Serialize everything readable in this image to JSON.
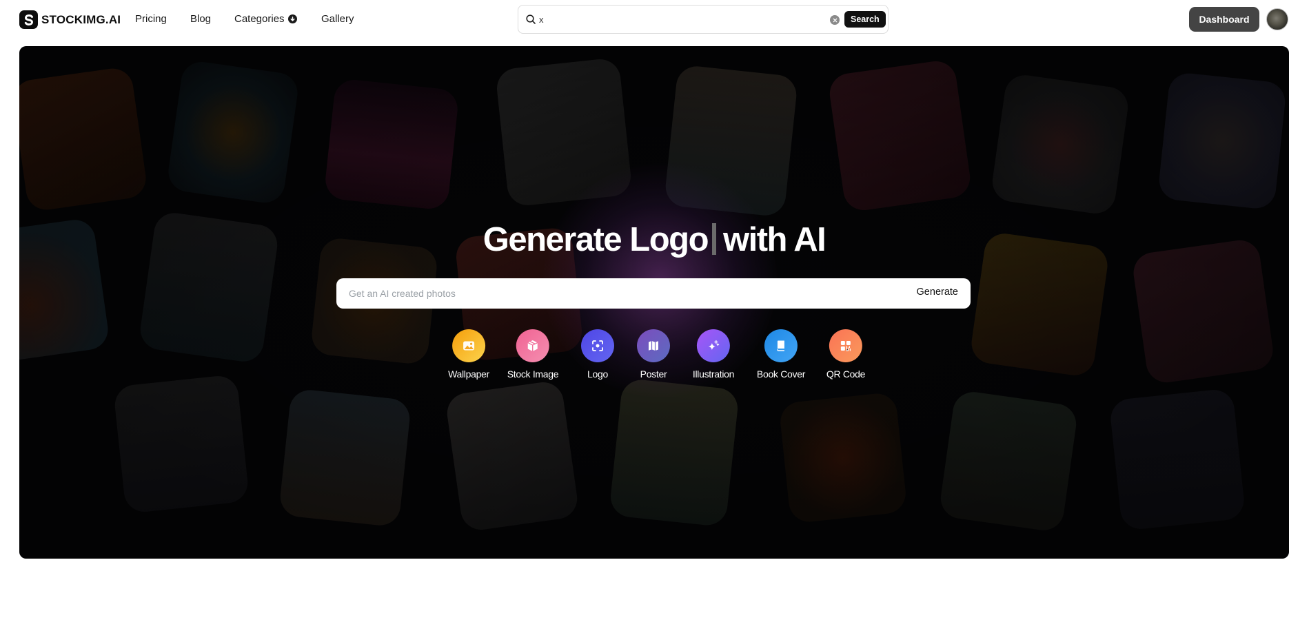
{
  "nav": {
    "brand": "STOCKIMG.AI",
    "links": [
      {
        "label": "Pricing"
      },
      {
        "label": "Blog"
      },
      {
        "label": "Categories",
        "has_dropdown": true
      },
      {
        "label": "Gallery"
      }
    ],
    "search": {
      "value": "x",
      "button_label": "Search"
    },
    "dashboard_label": "Dashboard"
  },
  "hero": {
    "headline_typed": "Generate Logo",
    "headline_rest": "with AI",
    "prompt": {
      "placeholder": "Get an AI created photos",
      "value": "",
      "button_label": "Generate"
    },
    "categories": [
      {
        "label": "Wallpaper",
        "icon": "image-icon",
        "gradient": [
          "#f59e0b",
          "#fcd34d"
        ]
      },
      {
        "label": "Stock Image",
        "icon": "package-icon",
        "gradient": [
          "#f06292",
          "#f48fb1"
        ]
      },
      {
        "label": "Logo",
        "icon": "focus-icon",
        "gradient": [
          "#4f46e5",
          "#6366f1"
        ]
      },
      {
        "label": "Poster",
        "icon": "map-icon",
        "gradient": [
          "#7c4dbe",
          "#5c6bc0"
        ]
      },
      {
        "label": "Illustration",
        "icon": "sparkles-icon",
        "gradient": [
          "#a855f7",
          "#6366f1"
        ]
      },
      {
        "label": "Book Cover",
        "icon": "book-icon",
        "gradient": [
          "#1e88e5",
          "#42a5f5"
        ]
      },
      {
        "label": "QR Code",
        "icon": "qr-code-icon",
        "gradient": [
          "#f97355",
          "#fb9a5c"
        ]
      }
    ]
  }
}
